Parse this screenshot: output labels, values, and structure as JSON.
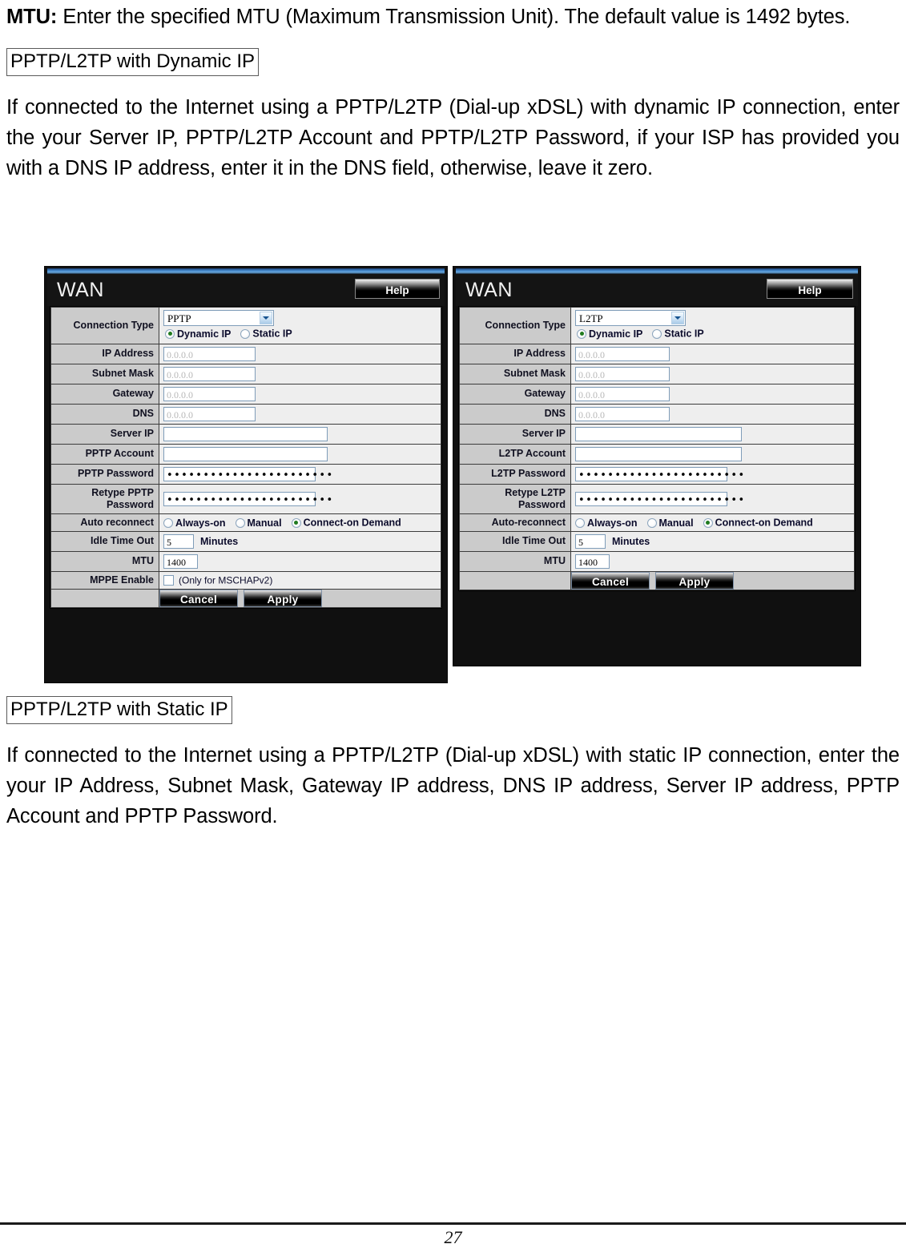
{
  "document": {
    "intro": {
      "label": "MTU:",
      "text": " Enter the specified MTU (Maximum Transmission Unit). The default value is 1492 bytes."
    },
    "heading_dynamic": "PPTP/L2TP with Dynamic IP",
    "para_dynamic": "If connected to the Internet using a PPTP/L2TP (Dial-up xDSL) with dynamic IP connection, enter the your Server IP, PPTP/L2TP Account and PPTP/L2TP Password, if your ISP has provided you with a DNS IP address, enter it in the DNS field, otherwise, leave it zero.",
    "heading_static": "PPTP/L2TP with Static IP",
    "para_static": "If connected to the Internet using a PPTP/L2TP (Dial-up xDSL) with static IP connection, enter the your IP Address, Subnet Mask, Gateway IP address, DNS IP address, Server IP address, PPTP Account and PPTP Password.",
    "page_number": "27"
  },
  "panels": {
    "pptp": {
      "title": "WAN",
      "help_label": "Help",
      "rows": {
        "connection_type_label": "Connection Type",
        "connection_type_value": "PPTP",
        "ip_mode_dynamic": "Dynamic IP",
        "ip_mode_static": "Static IP",
        "ip_address_label": "IP Address",
        "ip_address_value": "0.0.0.0",
        "subnet_mask_label": "Subnet Mask",
        "subnet_mask_value": "0.0.0.0",
        "gateway_label": "Gateway",
        "gateway_value": "0.0.0.0",
        "dns_label": "DNS",
        "dns_value": "0.0.0.0",
        "server_ip_label": "Server IP",
        "server_ip_value": "",
        "account_label": "PPTP Account",
        "account_value": "",
        "password_label": "PPTP Password",
        "password_value": "•••••••••••••••••••••••",
        "retype_password_label": "Retype PPTP Password",
        "retype_password_value": "•••••••••••••••••••••••",
        "auto_reconnect_label": "Auto reconnect",
        "auto_always_on": "Always-on",
        "auto_manual": "Manual",
        "auto_connect_on_demand": "Connect-on Demand",
        "idle_time_out_label": "Idle Time Out",
        "idle_time_out_value": "5",
        "idle_time_out_unit": "Minutes",
        "mtu_label": "MTU",
        "mtu_value": "1400",
        "mppe_label": "MPPE Enable",
        "mppe_note": "(Only for MSCHAPv2)",
        "cancel_label": "Cancel",
        "apply_label": "Apply"
      }
    },
    "l2tp": {
      "title": "WAN",
      "help_label": "Help",
      "rows": {
        "connection_type_label": "Connection Type",
        "connection_type_value": "L2TP",
        "ip_mode_dynamic": "Dynamic IP",
        "ip_mode_static": "Static IP",
        "ip_address_label": "IP Address",
        "ip_address_value": "0.0.0.0",
        "subnet_mask_label": "Subnet Mask",
        "subnet_mask_value": "0.0.0.0",
        "gateway_label": "Gateway",
        "gateway_value": "0.0.0.0",
        "dns_label": "DNS",
        "dns_value": "0.0.0.0",
        "server_ip_label": "Server IP",
        "server_ip_value": "",
        "account_label": "L2TP Account",
        "account_value": "",
        "password_label": "L2TP Password",
        "password_value": "•••••••••••••••••••••••",
        "retype_password_label": "Retype L2TP Password",
        "retype_password_value": "•••••••••••••••••••••••",
        "auto_reconnect_label": "Auto-reconnect",
        "auto_always_on": "Always-on",
        "auto_manual": "Manual",
        "auto_connect_on_demand": "Connect-on Demand",
        "idle_time_out_label": "Idle Time Out",
        "idle_time_out_value": "5",
        "idle_time_out_unit": "Minutes",
        "mtu_label": "MTU",
        "mtu_value": "1400",
        "cancel_label": "Cancel",
        "apply_label": "Apply"
      }
    }
  }
}
